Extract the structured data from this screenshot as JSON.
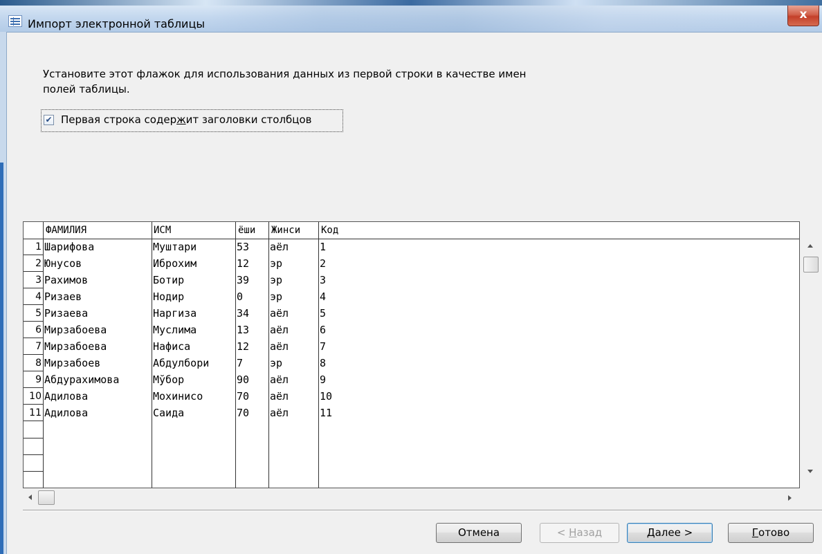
{
  "window": {
    "title": "Импорт электронной таблицы",
    "close_label": "x"
  },
  "instruction": "Установите этот флажок для использования данных из первой строки в качестве имен полей таблицы.",
  "first_row_checkbox": {
    "checked": true,
    "label_before": "Первая строка содер",
    "label_hotkey": "ж",
    "label_after": "ит заголовки столбцов"
  },
  "table": {
    "columns": [
      "ФАМИЛИЯ",
      "ИСМ",
      "ёши",
      "Жинси",
      "Код"
    ],
    "rows": [
      {
        "num": "1",
        "cells": [
          "Шарифова",
          "Муштари",
          "53",
          "аёл",
          "1"
        ]
      },
      {
        "num": "2",
        "cells": [
          "Юнусов",
          "Иброхим",
          "12",
          "эр",
          "2"
        ]
      },
      {
        "num": "3",
        "cells": [
          "Рахимов",
          "Ботир",
          "39",
          "эр",
          "3"
        ]
      },
      {
        "num": "4",
        "cells": [
          "Ризаев",
          "Нодир",
          "0",
          "эр",
          "4"
        ]
      },
      {
        "num": "5",
        "cells": [
          "Ризаева",
          "Наргиза",
          "34",
          "аёл",
          "5"
        ]
      },
      {
        "num": "6",
        "cells": [
          "Мирзабоева",
          "Муслима",
          "13",
          "аёл",
          "6"
        ]
      },
      {
        "num": "7",
        "cells": [
          "Мирзабоева",
          "Нафиса",
          "12",
          "аёл",
          "7"
        ]
      },
      {
        "num": "8",
        "cells": [
          "Мирзабоев",
          "Абдулбори",
          "7",
          "эр",
          "8"
        ]
      },
      {
        "num": "9",
        "cells": [
          "Абдурахимова",
          "Мўбор",
          "90",
          "аёл",
          "9"
        ]
      },
      {
        "num": "10",
        "cells": [
          "Адилова",
          "Мохинисо",
          "70",
          "аёл",
          "10"
        ]
      },
      {
        "num": "11",
        "cells": [
          "Адилова",
          "Саида",
          "70",
          "аёл",
          "11"
        ]
      }
    ]
  },
  "buttons": {
    "cancel": "Отмена",
    "back_prefix": "< ",
    "back_hotkey": "Н",
    "back_rest": "азад",
    "next_hotkey": "Д",
    "next_rest": "алее >",
    "finish_hotkey": "Г",
    "finish_rest": "отово"
  }
}
